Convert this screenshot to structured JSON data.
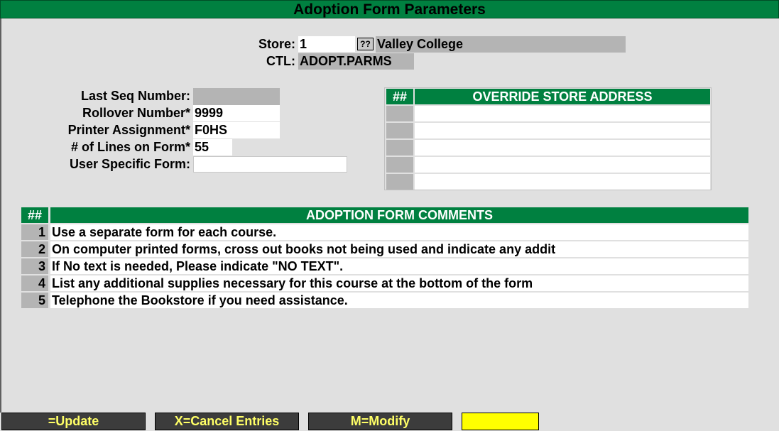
{
  "window_title": "Adoption Form Parameters",
  "header": {
    "store_label": "Store:",
    "store_value": "1",
    "lookup_button": "??",
    "store_name": "Valley College",
    "ctl_label": "CTL:",
    "ctl_value": "ADOPT.PARMS"
  },
  "params": {
    "last_seq_label": "Last Seq Number:",
    "last_seq_value": "",
    "rollover_label": "Rollover Number*",
    "rollover_value": "9999",
    "printer_label": "Printer Assignment*",
    "printer_value": "F0HS",
    "lines_label": "# of Lines on Form*",
    "lines_value": "55",
    "user_form_label": "User Specific Form:",
    "user_form_value": ""
  },
  "override_table": {
    "num_header": "##",
    "title": "OVERRIDE STORE ADDRESS",
    "rows": [
      "",
      "",
      "",
      "",
      ""
    ]
  },
  "comments_table": {
    "num_header": "##",
    "title": "ADOPTION FORM COMMENTS",
    "rows": [
      {
        "num": "1",
        "text": "Use a separate form for each course."
      },
      {
        "num": "2",
        "text": "On computer printed forms, cross out books not being used and indicate any addit"
      },
      {
        "num": "3",
        "text": "If No text is needed, Please indicate \"NO TEXT\"."
      },
      {
        "num": "4",
        "text": "List any additional supplies necessary for this course at the bottom of the form"
      },
      {
        "num": "5",
        "text": "Telephone the Bookstore if you need assistance."
      }
    ]
  },
  "footer": {
    "update": "=Update",
    "cancel": "X=Cancel Entries",
    "modify": "M=Modify",
    "blank": ""
  },
  "colors": {
    "header_green": "#008040",
    "background": "#e0e0e0",
    "fkey_text": "#ffff66",
    "highlight": "#ffff00"
  }
}
